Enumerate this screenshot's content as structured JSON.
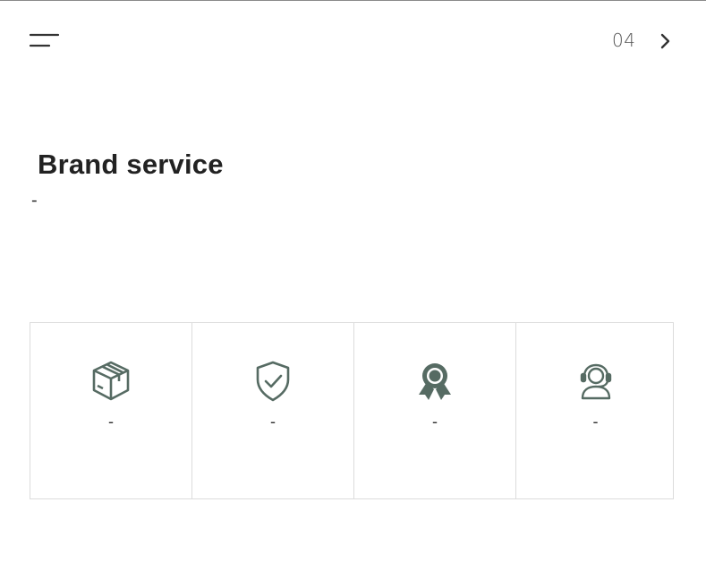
{
  "header": {
    "page_indicator": "04"
  },
  "main": {
    "title": "Brand service",
    "subtext": "-"
  },
  "services": [
    {
      "icon": "package-icon",
      "text": "-"
    },
    {
      "icon": "shield-check-icon",
      "text": "-"
    },
    {
      "icon": "award-ribbon-icon",
      "text": "-"
    },
    {
      "icon": "headset-support-icon",
      "text": "-"
    }
  ],
  "colors": {
    "icon": "#566b63",
    "text": "#222222",
    "border": "#dcdcdc"
  }
}
